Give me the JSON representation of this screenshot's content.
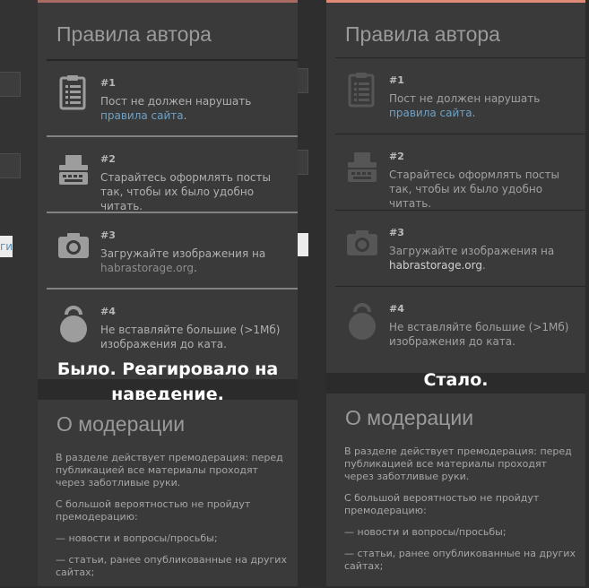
{
  "panels": {
    "before": {
      "rules_title": "Правила автора",
      "rules": [
        {
          "num": "#1",
          "text": "Пост не должен нарушать ",
          "link": "правила сайта",
          "after": ".",
          "icon": "clipboard-icon"
        },
        {
          "num": "#2",
          "text": "Старайтесь оформлять посты так, чтобы их было удобно читать.",
          "icon": "typewriter-icon"
        },
        {
          "num": "#3",
          "text": "Загружайте изображения на ",
          "link": "habrastorage.org",
          "after": ".",
          "icon": "camera-icon"
        },
        {
          "num": "#4",
          "text": "Не вставляйте большие (>1Мб) изображения до ката.",
          "icon": "weight-icon"
        }
      ],
      "caption": "Было. Реагировало на наведение.",
      "moderation_title": "О модерации",
      "moderation_paragraphs": [
        "В разделе действует премодерация: перед публикацией все материалы проходят через заботливые руки.",
        "С большой вероятностью не пройдут премодерацию:",
        "— новости и вопросы/просьбы;",
        "— статьи, ранее опубликованные на других сайтах;"
      ]
    },
    "after": {
      "rules_title": "Правила автора",
      "rules": [
        {
          "num": "#1",
          "text": "Пост не должен нарушать ",
          "link": "правила сайта",
          "after": ".",
          "icon": "clipboard-icon"
        },
        {
          "num": "#2",
          "text": "Старайтесь оформлять посты так, чтобы их было удобно читать.",
          "icon": "typewriter-icon"
        },
        {
          "num": "#3",
          "text": "Загружайте изображения на ",
          "link": "habrastorage.org",
          "after": ".",
          "icon": "camera-icon"
        },
        {
          "num": "#4",
          "text": "Не вставляйте большие (>1Мб) изображения до ката.",
          "icon": "weight-icon"
        }
      ],
      "caption": "Стало.",
      "moderation_title": "О модерации",
      "moderation_paragraphs": [
        "В разделе действует премодерация: перед публикацией все материалы проходят через заботливые руки.",
        "С большой вероятностью не пройдут премодерацию:",
        "— новости и вопросы/просьбы;",
        "— статьи, ранее опубликованные на других сайтах;"
      ]
    }
  },
  "background": {
    "left_strip_text": "ги"
  },
  "colors": {
    "accent_before": "#a86a62",
    "accent_after": "#e08a78",
    "link": "#6fa2c6"
  }
}
